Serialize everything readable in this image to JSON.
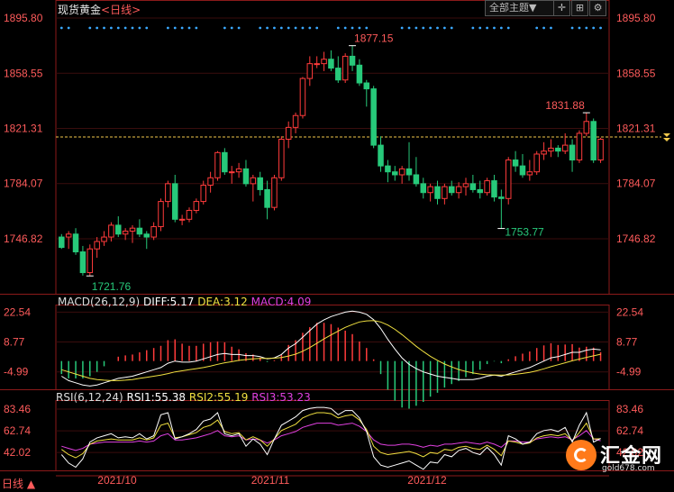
{
  "header": {
    "title": "现货黄金",
    "period_label": "<日线>",
    "theme_button": "全部主题▼",
    "icons": [
      "crosshair-icon",
      "zoom-icon",
      "settings-icon"
    ]
  },
  "footer": {
    "period": "日线",
    "period_arrow": "▲"
  },
  "logo": {
    "text": "汇金网",
    "sub": "gold678.com"
  },
  "colors": {
    "up": "#ff3b3b",
    "down": "#27c97a",
    "price_line": "#f2c94c",
    "white": "#ffffff",
    "yellow": "#f0e040",
    "magenta": "#e040e0",
    "axis_label": "#ff5b5b",
    "dot": "#3ba9ff"
  },
  "chart_data": [
    {
      "type": "candlestick",
      "name": "main",
      "y_ticks": [
        "1895.80",
        "1858.55",
        "1821.31",
        "1784.07",
        "1746.82"
      ],
      "ylim": [
        1746.82,
        1895.8
      ],
      "x_labels": [
        "2021/10",
        "2021/11",
        "2021/12"
      ],
      "annotations": {
        "high": "1877.15",
        "low": "1721.76",
        "low2": "1753.77",
        "recent_high": "1831.88"
      },
      "current_price": 1815.5,
      "candles": [
        [
          1748,
          1750,
          1740,
          1741
        ],
        [
          1748,
          1752,
          1740,
          1750
        ],
        [
          1750,
          1754,
          1736,
          1738
        ],
        [
          1738,
          1742,
          1722,
          1724
        ],
        [
          1724,
          1743,
          1721.76,
          1740
        ],
        [
          1740,
          1748,
          1734,
          1745
        ],
        [
          1745,
          1752,
          1742,
          1748
        ],
        [
          1748,
          1758,
          1745,
          1756
        ],
        [
          1756,
          1762,
          1748,
          1750
        ],
        [
          1750,
          1754,
          1746,
          1752
        ],
        [
          1752,
          1756,
          1744,
          1754
        ],
        [
          1754,
          1760,
          1748,
          1750
        ],
        [
          1750,
          1752,
          1740,
          1748
        ],
        [
          1748,
          1758,
          1746,
          1755
        ],
        [
          1755,
          1774,
          1752,
          1772
        ],
        [
          1772,
          1786,
          1768,
          1784
        ],
        [
          1784,
          1790,
          1758,
          1760
        ],
        [
          1760,
          1763,
          1756,
          1760
        ],
        [
          1760,
          1768,
          1758,
          1766
        ],
        [
          1766,
          1774,
          1764,
          1772
        ],
        [
          1772,
          1786,
          1770,
          1783
        ],
        [
          1783,
          1792,
          1778,
          1788
        ],
        [
          1788,
          1806,
          1786,
          1805
        ],
        [
          1805,
          1808,
          1790,
          1792
        ],
        [
          1792,
          1796,
          1784,
          1792
        ],
        [
          1792,
          1798,
          1788,
          1794
        ],
        [
          1794,
          1800,
          1782,
          1784
        ],
        [
          1784,
          1790,
          1772,
          1788
        ],
        [
          1788,
          1792,
          1776,
          1780
        ],
        [
          1780,
          1786,
          1760,
          1768
        ],
        [
          1768,
          1790,
          1766,
          1788
        ],
        [
          1788,
          1816,
          1786,
          1814
        ],
        [
          1814,
          1826,
          1808,
          1822
        ],
        [
          1822,
          1832,
          1818,
          1830
        ],
        [
          1830,
          1856,
          1828,
          1855
        ],
        [
          1855,
          1870,
          1850,
          1865
        ],
        [
          1865,
          1870,
          1862,
          1865
        ],
        [
          1865,
          1873,
          1860,
          1868
        ],
        [
          1868,
          1874,
          1860,
          1862
        ],
        [
          1862,
          1870,
          1852,
          1854
        ],
        [
          1854,
          1872,
          1852,
          1870
        ],
        [
          1870,
          1877.15,
          1860,
          1864
        ],
        [
          1864,
          1868,
          1850,
          1852
        ],
        [
          1852,
          1854,
          1836,
          1848
        ],
        [
          1848,
          1850,
          1808,
          1810
        ],
        [
          1810,
          1816,
          1792,
          1796
        ],
        [
          1796,
          1800,
          1785,
          1792
        ],
        [
          1792,
          1796,
          1786,
          1790
        ],
        [
          1790,
          1796,
          1784,
          1794
        ],
        [
          1794,
          1812,
          1786,
          1790
        ],
        [
          1790,
          1802,
          1782,
          1784
        ],
        [
          1784,
          1788,
          1774,
          1778
        ],
        [
          1778,
          1784,
          1772,
          1782
        ],
        [
          1782,
          1786,
          1770,
          1774
        ],
        [
          1774,
          1784,
          1770,
          1782
        ],
        [
          1782,
          1786,
          1776,
          1778
        ],
        [
          1778,
          1785,
          1774,
          1782
        ],
        [
          1782,
          1788,
          1776,
          1784
        ],
        [
          1784,
          1790,
          1778,
          1780
        ],
        [
          1780,
          1786,
          1774,
          1778
        ],
        [
          1778,
          1788,
          1776,
          1786
        ],
        [
          1786,
          1790,
          1772,
          1775
        ],
        [
          1775,
          1780,
          1753.77,
          1774
        ],
        [
          1774,
          1802,
          1770,
          1800
        ],
        [
          1800,
          1806,
          1792,
          1796
        ],
        [
          1796,
          1804,
          1788,
          1790
        ],
        [
          1790,
          1800,
          1786,
          1792
        ],
        [
          1792,
          1806,
          1790,
          1804
        ],
        [
          1804,
          1812,
          1800,
          1806
        ],
        [
          1806,
          1814,
          1802,
          1808
        ],
        [
          1808,
          1810,
          1802,
          1806
        ],
        [
          1806,
          1818,
          1804,
          1810
        ],
        [
          1810,
          1814,
          1792,
          1800
        ],
        [
          1800,
          1820,
          1798,
          1818
        ],
        [
          1818,
          1831.88,
          1816,
          1826
        ],
        [
          1826,
          1828,
          1798,
          1800
        ],
        [
          1800,
          1815,
          1798,
          1814
        ]
      ]
    },
    {
      "type": "macd",
      "name": "MACD",
      "title": "MACD(26,12,9)",
      "values_label": {
        "diff": "DIFF:5.17",
        "dea": "DEA:3.12",
        "macd": "MACD:4.09"
      },
      "y_ticks": [
        "22.54",
        "8.77",
        "-4.99"
      ],
      "ylim": [
        -13,
        26
      ],
      "diff": [
        -7,
        -9,
        -10,
        -11,
        -11.5,
        -11,
        -10,
        -9,
        -8,
        -7.5,
        -7,
        -6,
        -5,
        -4,
        -3,
        -1,
        0,
        -0.5,
        -0.5,
        0,
        1,
        2,
        3,
        3.5,
        3,
        3,
        2.5,
        2.5,
        2,
        1,
        1.5,
        3,
        6,
        8,
        11,
        14,
        17,
        19,
        20.5,
        21.5,
        22.5,
        23,
        22.5,
        21.5,
        19,
        15,
        10,
        5.5,
        1.5,
        -1.5,
        -3.5,
        -5,
        -6,
        -7,
        -7.5,
        -8,
        -8.5,
        -8.5,
        -8.5,
        -8,
        -7,
        -6.5,
        -7,
        -6,
        -5,
        -4,
        -3,
        -1.5,
        0,
        1.5,
        2,
        3,
        4,
        4,
        5,
        5.5,
        5.17
      ],
      "dea": [
        -4,
        -5,
        -6,
        -7,
        -8,
        -8.5,
        -8.8,
        -9,
        -9,
        -8.8,
        -8.5,
        -8,
        -7.5,
        -7,
        -6.5,
        -5.8,
        -5,
        -4.5,
        -4,
        -3.5,
        -3,
        -2.3,
        -1.5,
        -0.8,
        -0.3,
        0.3,
        0.7,
        1,
        1.2,
        1.2,
        1.3,
        1.6,
        2.3,
        3.2,
        4.5,
        6.2,
        8.2,
        10.2,
        12,
        13.8,
        15.5,
        16.8,
        18,
        18.5,
        18.6,
        18,
        16.6,
        14.6,
        12.2,
        9.5,
        6.8,
        4.4,
        2.2,
        0.3,
        -1.4,
        -2.7,
        -3.9,
        -4.8,
        -5.5,
        -6,
        -6.3,
        -6.4,
        -6.5,
        -6.4,
        -6.1,
        -5.7,
        -5.2,
        -4.5,
        -3.6,
        -2.6,
        -1.7,
        -0.8,
        0.1,
        0.9,
        1.7,
        2.4,
        3.12
      ],
      "macd": [
        -6,
        -8,
        -8,
        -8,
        -7,
        -5,
        -2.4,
        0,
        2,
        2.6,
        3,
        4,
        5,
        6,
        7,
        9.6,
        10,
        8,
        7,
        7,
        8,
        8.6,
        9,
        8.6,
        6.6,
        5.4,
        3.6,
        3,
        1.6,
        -0.4,
        0.4,
        2.8,
        7.4,
        9.6,
        13,
        15.6,
        17.6,
        17.6,
        17,
        15.4,
        14,
        12.4,
        9,
        6,
        0.8,
        -6,
        -13.2,
        -18.2,
        -21.4,
        -22,
        -20.6,
        -18.8,
        -16.4,
        -14.6,
        -12.2,
        -10.6,
        -9.2,
        -7.4,
        -6,
        -4,
        -1.4,
        -0.2,
        -1,
        0.8,
        2.2,
        3.4,
        4.4,
        6,
        7.2,
        8.2,
        7.4,
        7.6,
        7.8,
        6.2,
        6.6,
        6.2,
        4.09
      ]
    },
    {
      "type": "rsi",
      "name": "RSI",
      "title": "RSI(6,12,24)",
      "values_label": {
        "rsi1": "RSI1:55.38",
        "rsi2": "RSI2:55.19",
        "rsi3": "RSI3:53.23"
      },
      "y_ticks": [
        "83.46",
        "62.74",
        "42.02"
      ],
      "ylim": [
        25,
        92
      ],
      "rsi1": [
        40,
        32,
        28,
        36,
        52,
        56,
        58,
        60,
        56,
        57,
        56,
        60,
        55,
        58,
        78,
        80,
        55,
        57,
        60,
        64,
        72,
        74,
        80,
        60,
        58,
        60,
        48,
        55,
        50,
        40,
        55,
        68,
        72,
        76,
        82,
        84,
        85,
        85,
        84,
        78,
        82,
        82,
        75,
        62,
        38,
        30,
        28,
        30,
        32,
        34,
        30,
        26,
        33,
        32,
        40,
        38,
        44,
        46,
        42,
        40,
        47,
        40,
        30,
        58,
        55,
        50,
        52,
        60,
        63,
        64,
        62,
        66,
        52,
        68,
        80,
        52,
        55.38
      ],
      "rsi2": [
        45,
        40,
        37,
        41,
        50,
        53,
        54,
        55,
        54,
        54,
        54,
        56,
        54,
        56,
        68,
        70,
        56,
        57,
        59,
        61,
        66,
        68,
        73,
        62,
        60,
        61,
        54,
        57,
        54,
        48,
        55,
        63,
        66,
        69,
        75,
        78,
        80,
        80,
        79,
        75,
        77,
        78,
        73,
        64,
        48,
        42,
        40,
        41,
        42,
        43,
        41,
        38,
        42,
        41,
        45,
        44,
        47,
        48,
        46,
        45,
        49,
        45,
        39,
        53,
        52,
        50,
        51,
        56,
        58,
        59,
        58,
        60,
        53,
        61,
        70,
        55,
        55.19
      ],
      "rsi3": [
        48,
        46,
        44,
        46,
        50,
        51,
        52,
        52,
        52,
        52,
        52,
        53,
        52,
        53,
        58,
        60,
        54,
        54,
        55,
        56,
        58,
        60,
        63,
        58,
        57,
        58,
        54,
        55,
        54,
        51,
        54,
        58,
        60,
        62,
        66,
        68,
        70,
        70,
        70,
        68,
        69,
        70,
        67,
        62,
        54,
        50,
        49,
        49,
        50,
        50,
        49,
        47,
        49,
        48,
        50,
        50,
        51,
        52,
        51,
        50,
        52,
        50,
        47,
        53,
        53,
        52,
        52,
        55,
        56,
        57,
        56,
        57,
        54,
        58,
        63,
        55,
        53.23
      ]
    }
  ]
}
